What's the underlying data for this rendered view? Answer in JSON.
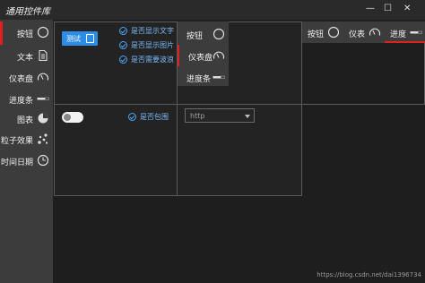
{
  "app": {
    "title": "通用控件库"
  },
  "window_controls": {
    "minimize": "—",
    "maximize": "☐",
    "close": "✕"
  },
  "sidebar": {
    "items": [
      {
        "label": "按钮",
        "icon": "circle-icon"
      },
      {
        "label": "文本",
        "icon": "document-icon"
      },
      {
        "label": "仪表盘",
        "icon": "gauge-icon"
      },
      {
        "label": "进度条",
        "icon": "progress-bar-icon"
      },
      {
        "label": "图表",
        "icon": "pie-chart-icon"
      },
      {
        "label": "粒子效果",
        "icon": "particles-icon"
      },
      {
        "label": "时间日期",
        "icon": "clock-icon"
      }
    ],
    "active_index": 0
  },
  "button_panel": {
    "test_button": {
      "label": "测试",
      "icon": "person-icon"
    },
    "checkboxes": [
      {
        "label": "是否显示文字",
        "checked": true
      },
      {
        "label": "是否显示图片",
        "checked": true
      },
      {
        "label": "是否需要波浪",
        "checked": true
      }
    ]
  },
  "vertical_menu": {
    "items": [
      {
        "label": "按钮",
        "icon": "circle-icon"
      },
      {
        "label": "仪表盘",
        "icon": "gauge-icon"
      },
      {
        "label": "进度条",
        "icon": "progress-bar-icon"
      }
    ],
    "active_index": 1
  },
  "horizontal_menu": {
    "items": [
      {
        "label": "按钮",
        "icon": "circle-icon"
      },
      {
        "label": "仪表",
        "icon": "gauge-icon"
      },
      {
        "label": "进度",
        "icon": "progress-bar-icon"
      }
    ],
    "active_index": 2
  },
  "toggle_panel": {
    "checkbox_label": "是否包围",
    "checked": true,
    "toggle_on": false
  },
  "combo": {
    "value": "http"
  },
  "watermark": "https://blog.csdn.net/dai1396734",
  "colors": {
    "accent": "#2d8ce6",
    "active_indicator": "#e02020",
    "sidebar_bg": "#3c3c3c",
    "content_bg": "#1e1e1e"
  }
}
